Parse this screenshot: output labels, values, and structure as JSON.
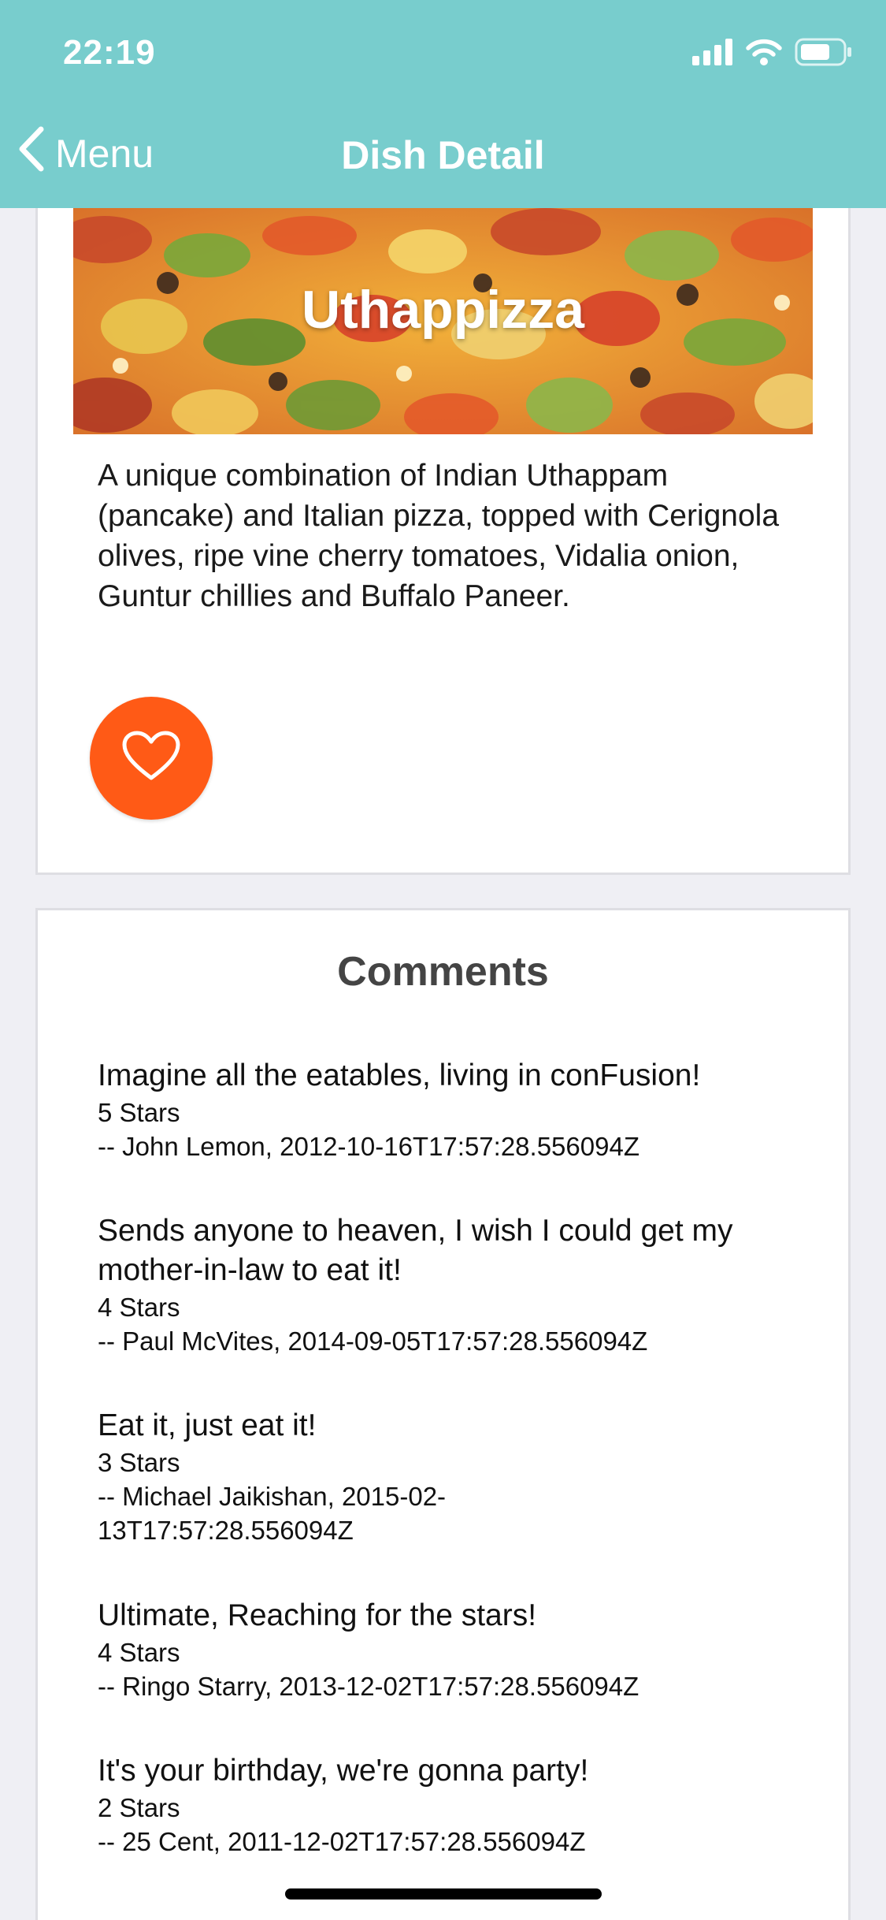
{
  "status_bar": {
    "time": "22:19",
    "icons": [
      "signal-icon",
      "wifi-icon",
      "battery-icon"
    ]
  },
  "nav": {
    "back_label": "Menu",
    "title": "Dish Detail"
  },
  "dish": {
    "name": "Uthappizza",
    "description": "A unique combination of Indian Uthappam (pancake) and Italian pizza, topped with Cerignola olives, ripe vine cherry tomatoes, Vidalia onion, Guntur chillies and Buffalo Paneer.",
    "favorite_icon": "heart-outline-icon"
  },
  "comments": {
    "title": "Comments",
    "items": [
      {
        "text": "Imagine all the eatables, living in conFusion!",
        "rating": "5 Stars",
        "author": "-- John Lemon, 2012-10-16T17:57:28.556094Z"
      },
      {
        "text": "Sends anyone to heaven, I wish I could get my mother-in-law to eat it!",
        "rating": "4 Stars",
        "author": "-- Paul McVites, 2014-09-05T17:57:28.556094Z"
      },
      {
        "text": "Eat it, just eat it!",
        "rating": "3 Stars",
        "author": "-- Michael Jaikishan, 2015-02-13T17:57:28.556094Z"
      },
      {
        "text": "Ultimate, Reaching for the stars!",
        "rating": "4 Stars",
        "author": "-- Ringo Starry, 2013-12-02T17:57:28.556094Z"
      },
      {
        "text": "It's your birthday, we're gonna party!",
        "rating": "2 Stars",
        "author": "-- 25 Cent, 2011-12-02T17:57:28.556094Z"
      }
    ]
  },
  "colors": {
    "header": "#78cdcd",
    "favorite_button": "#ff5a16",
    "background": "#efeff4"
  }
}
